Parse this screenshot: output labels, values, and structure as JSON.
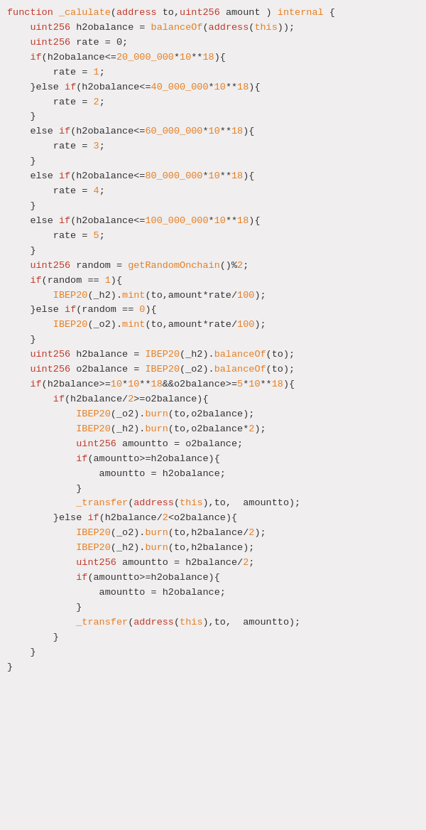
{
  "code": {
    "lines": [
      {
        "id": 1,
        "tokens": [
          {
            "t": "function",
            "c": "kw"
          },
          {
            "t": " ",
            "c": ""
          },
          {
            "t": "_calulate",
            "c": "fn"
          },
          {
            "t": "(",
            "c": ""
          },
          {
            "t": "address",
            "c": "kw"
          },
          {
            "t": " to,",
            "c": ""
          },
          {
            "t": "uint256",
            "c": "kw"
          },
          {
            "t": " amount ) ",
            "c": ""
          },
          {
            "t": "internal",
            "c": "fn"
          },
          {
            "t": " {",
            "c": ""
          }
        ]
      },
      {
        "id": 2,
        "tokens": [
          {
            "t": "    ",
            "c": ""
          },
          {
            "t": "uint256",
            "c": "kw"
          },
          {
            "t": " h2obalance = ",
            "c": ""
          },
          {
            "t": "balanceOf",
            "c": "fn"
          },
          {
            "t": "(",
            "c": ""
          },
          {
            "t": "address",
            "c": "kw"
          },
          {
            "t": "(",
            "c": ""
          },
          {
            "t": "this",
            "c": "fn"
          },
          {
            "t": "));",
            "c": ""
          }
        ]
      },
      {
        "id": 3,
        "tokens": [
          {
            "t": "    ",
            "c": ""
          },
          {
            "t": "uint256",
            "c": "kw"
          },
          {
            "t": " rate = 0;",
            "c": ""
          }
        ]
      },
      {
        "id": 4,
        "tokens": [
          {
            "t": "    ",
            "c": ""
          },
          {
            "t": "if",
            "c": "kw"
          },
          {
            "t": "(h2obalance<=",
            "c": ""
          },
          {
            "t": "20_000_000",
            "c": "fn"
          },
          {
            "t": "*",
            "c": ""
          },
          {
            "t": "10",
            "c": "fn"
          },
          {
            "t": "**",
            "c": ""
          },
          {
            "t": "18",
            "c": "fn"
          },
          {
            "t": "){",
            "c": ""
          }
        ]
      },
      {
        "id": 5,
        "tokens": [
          {
            "t": "        rate = ",
            "c": ""
          },
          {
            "t": "1",
            "c": "fn"
          },
          {
            "t": ";",
            "c": ""
          }
        ]
      },
      {
        "id": 6,
        "tokens": [
          {
            "t": "    }",
            "c": ""
          },
          {
            "t": "else ",
            "c": ""
          },
          {
            "t": "if",
            "c": "kw"
          },
          {
            "t": "(h2obalance<=",
            "c": ""
          },
          {
            "t": "40_000_000",
            "c": "fn"
          },
          {
            "t": "*",
            "c": ""
          },
          {
            "t": "10",
            "c": "fn"
          },
          {
            "t": "**",
            "c": ""
          },
          {
            "t": "18",
            "c": "fn"
          },
          {
            "t": "){",
            "c": ""
          }
        ]
      },
      {
        "id": 7,
        "tokens": [
          {
            "t": "        rate = ",
            "c": ""
          },
          {
            "t": "2",
            "c": "fn"
          },
          {
            "t": ";",
            "c": ""
          }
        ]
      },
      {
        "id": 8,
        "tokens": [
          {
            "t": "    }",
            "c": ""
          }
        ]
      },
      {
        "id": 9,
        "tokens": [
          {
            "t": "    ",
            "c": ""
          },
          {
            "t": "else ",
            "c": ""
          },
          {
            "t": "if",
            "c": "kw"
          },
          {
            "t": "(h2obalance<=",
            "c": ""
          },
          {
            "t": "60_000_000",
            "c": "fn"
          },
          {
            "t": "*",
            "c": ""
          },
          {
            "t": "10",
            "c": "fn"
          },
          {
            "t": "**",
            "c": ""
          },
          {
            "t": "18",
            "c": "fn"
          },
          {
            "t": "){",
            "c": ""
          }
        ]
      },
      {
        "id": 10,
        "tokens": [
          {
            "t": "        rate = ",
            "c": ""
          },
          {
            "t": "3",
            "c": "fn"
          },
          {
            "t": ";",
            "c": ""
          }
        ]
      },
      {
        "id": 11,
        "tokens": [
          {
            "t": "    }",
            "c": ""
          }
        ]
      },
      {
        "id": 12,
        "tokens": [
          {
            "t": "    ",
            "c": ""
          },
          {
            "t": "else ",
            "c": ""
          },
          {
            "t": "if",
            "c": "kw"
          },
          {
            "t": "(h2obalance<=",
            "c": ""
          },
          {
            "t": "80_000_000",
            "c": "fn"
          },
          {
            "t": "*",
            "c": ""
          },
          {
            "t": "10",
            "c": "fn"
          },
          {
            "t": "**",
            "c": ""
          },
          {
            "t": "18",
            "c": "fn"
          },
          {
            "t": "){",
            "c": ""
          }
        ]
      },
      {
        "id": 13,
        "tokens": [
          {
            "t": "        rate = ",
            "c": ""
          },
          {
            "t": "4",
            "c": "fn"
          },
          {
            "t": ";",
            "c": ""
          }
        ]
      },
      {
        "id": 14,
        "tokens": [
          {
            "t": "    }",
            "c": ""
          }
        ]
      },
      {
        "id": 15,
        "tokens": [
          {
            "t": "    ",
            "c": ""
          },
          {
            "t": "else ",
            "c": ""
          },
          {
            "t": "if",
            "c": "kw"
          },
          {
            "t": "(h2obalance<=",
            "c": ""
          },
          {
            "t": "100_000_000",
            "c": "fn"
          },
          {
            "t": "*",
            "c": ""
          },
          {
            "t": "10",
            "c": "fn"
          },
          {
            "t": "**",
            "c": ""
          },
          {
            "t": "18",
            "c": "fn"
          },
          {
            "t": "){",
            "c": ""
          }
        ]
      },
      {
        "id": 16,
        "tokens": [
          {
            "t": "        rate = ",
            "c": ""
          },
          {
            "t": "5",
            "c": "fn"
          },
          {
            "t": ";",
            "c": ""
          }
        ]
      },
      {
        "id": 17,
        "tokens": [
          {
            "t": "    }",
            "c": ""
          }
        ]
      },
      {
        "id": 18,
        "tokens": [
          {
            "t": "    ",
            "c": ""
          },
          {
            "t": "uint256",
            "c": "kw"
          },
          {
            "t": " random = ",
            "c": ""
          },
          {
            "t": "getRandomOnchain",
            "c": "fn"
          },
          {
            "t": "()%",
            "c": ""
          },
          {
            "t": "2",
            "c": "fn"
          },
          {
            "t": ";",
            "c": ""
          }
        ]
      },
      {
        "id": 19,
        "tokens": [
          {
            "t": "    ",
            "c": ""
          },
          {
            "t": "if",
            "c": "kw"
          },
          {
            "t": "(random == ",
            "c": ""
          },
          {
            "t": "1",
            "c": "fn"
          },
          {
            "t": "){",
            "c": ""
          }
        ]
      },
      {
        "id": 20,
        "tokens": [
          {
            "t": "        ",
            "c": ""
          },
          {
            "t": "IBEP20",
            "c": "fn"
          },
          {
            "t": "(_h2).",
            "c": ""
          },
          {
            "t": "mint",
            "c": "fn"
          },
          {
            "t": "(to,amount*rate/",
            "c": ""
          },
          {
            "t": "100",
            "c": "fn"
          },
          {
            "t": ");",
            "c": ""
          }
        ]
      },
      {
        "id": 21,
        "tokens": [
          {
            "t": "    }",
            "c": ""
          },
          {
            "t": "else ",
            "c": ""
          },
          {
            "t": "if",
            "c": "kw"
          },
          {
            "t": "(random == ",
            "c": ""
          },
          {
            "t": "0",
            "c": "fn"
          },
          {
            "t": "){",
            "c": ""
          }
        ]
      },
      {
        "id": 22,
        "tokens": [
          {
            "t": "        ",
            "c": ""
          },
          {
            "t": "IBEP20",
            "c": "fn"
          },
          {
            "t": "(_o2).",
            "c": ""
          },
          {
            "t": "mint",
            "c": "fn"
          },
          {
            "t": "(to,amount*rate/",
            "c": ""
          },
          {
            "t": "100",
            "c": "fn"
          },
          {
            "t": ");",
            "c": ""
          }
        ]
      },
      {
        "id": 23,
        "tokens": [
          {
            "t": "    }",
            "c": ""
          }
        ]
      },
      {
        "id": 24,
        "tokens": [
          {
            "t": "    ",
            "c": ""
          },
          {
            "t": "uint256",
            "c": "kw"
          },
          {
            "t": " h2balance = ",
            "c": ""
          },
          {
            "t": "IBEP20",
            "c": "fn"
          },
          {
            "t": "(_h2).",
            "c": ""
          },
          {
            "t": "balanceOf",
            "c": "fn"
          },
          {
            "t": "(to);",
            "c": ""
          }
        ]
      },
      {
        "id": 25,
        "tokens": [
          {
            "t": "    ",
            "c": ""
          },
          {
            "t": "uint256",
            "c": "kw"
          },
          {
            "t": " o2balance = ",
            "c": ""
          },
          {
            "t": "IBEP20",
            "c": "fn"
          },
          {
            "t": "(_o2).",
            "c": ""
          },
          {
            "t": "balanceOf",
            "c": "fn"
          },
          {
            "t": "(to);",
            "c": ""
          }
        ]
      },
      {
        "id": 26,
        "tokens": [
          {
            "t": "    ",
            "c": ""
          },
          {
            "t": "if",
            "c": "kw"
          },
          {
            "t": "(h2balance>=",
            "c": ""
          },
          {
            "t": "10",
            "c": "fn"
          },
          {
            "t": "*",
            "c": ""
          },
          {
            "t": "10",
            "c": "fn"
          },
          {
            "t": "**",
            "c": ""
          },
          {
            "t": "18",
            "c": "fn"
          },
          {
            "t": "&&o2balance>=",
            "c": ""
          },
          {
            "t": "5",
            "c": "fn"
          },
          {
            "t": "*",
            "c": ""
          },
          {
            "t": "10",
            "c": "fn"
          },
          {
            "t": "**",
            "c": ""
          },
          {
            "t": "18",
            "c": "fn"
          },
          {
            "t": "){",
            "c": ""
          }
        ]
      },
      {
        "id": 27,
        "tokens": [
          {
            "t": "        ",
            "c": ""
          },
          {
            "t": "if",
            "c": "kw"
          },
          {
            "t": "(h2balance/",
            "c": ""
          },
          {
            "t": "2",
            "c": "fn"
          },
          {
            "t": ">=o2balance){",
            "c": ""
          }
        ]
      },
      {
        "id": 28,
        "tokens": [
          {
            "t": "            ",
            "c": ""
          },
          {
            "t": "IBEP20",
            "c": "fn"
          },
          {
            "t": "(_o2).",
            "c": ""
          },
          {
            "t": "burn",
            "c": "fn"
          },
          {
            "t": "(to,o2balance);",
            "c": ""
          }
        ]
      },
      {
        "id": 29,
        "tokens": [
          {
            "t": "            ",
            "c": ""
          },
          {
            "t": "IBEP20",
            "c": "fn"
          },
          {
            "t": "(_h2).",
            "c": ""
          },
          {
            "t": "burn",
            "c": "fn"
          },
          {
            "t": "(to,o2balance*",
            "c": ""
          },
          {
            "t": "2",
            "c": "fn"
          },
          {
            "t": ");",
            "c": ""
          }
        ]
      },
      {
        "id": 30,
        "tokens": [
          {
            "t": "            ",
            "c": ""
          },
          {
            "t": "uint256",
            "c": "kw"
          },
          {
            "t": " amountto = o2balance;",
            "c": ""
          }
        ]
      },
      {
        "id": 31,
        "tokens": [
          {
            "t": "            ",
            "c": ""
          },
          {
            "t": "if",
            "c": "kw"
          },
          {
            "t": "(amountto>=h2obalance){",
            "c": ""
          }
        ]
      },
      {
        "id": 32,
        "tokens": [
          {
            "t": "                amountto = h2obalance;",
            "c": ""
          }
        ]
      },
      {
        "id": 33,
        "tokens": [
          {
            "t": "            }",
            "c": ""
          }
        ]
      },
      {
        "id": 34,
        "tokens": [
          {
            "t": "            ",
            "c": ""
          },
          {
            "t": "_transfer",
            "c": "fn"
          },
          {
            "t": "(",
            "c": ""
          },
          {
            "t": "address",
            "c": "kw"
          },
          {
            "t": "(",
            "c": ""
          },
          {
            "t": "this",
            "c": "fn"
          },
          {
            "t": "),to,  amountto);",
            "c": ""
          }
        ]
      },
      {
        "id": 35,
        "tokens": [
          {
            "t": "        }",
            "c": ""
          },
          {
            "t": "else ",
            "c": ""
          },
          {
            "t": "if",
            "c": "kw"
          },
          {
            "t": "(h2balance/",
            "c": ""
          },
          {
            "t": "2",
            "c": "fn"
          },
          {
            "t": "<o2balance){",
            "c": ""
          }
        ]
      },
      {
        "id": 36,
        "tokens": [
          {
            "t": "            ",
            "c": ""
          },
          {
            "t": "IBEP20",
            "c": "fn"
          },
          {
            "t": "(_o2).",
            "c": ""
          },
          {
            "t": "burn",
            "c": "fn"
          },
          {
            "t": "(to,h2balance/",
            "c": ""
          },
          {
            "t": "2",
            "c": "fn"
          },
          {
            "t": ");",
            "c": ""
          }
        ]
      },
      {
        "id": 37,
        "tokens": [
          {
            "t": "            ",
            "c": ""
          },
          {
            "t": "IBEP20",
            "c": "fn"
          },
          {
            "t": "(_h2).",
            "c": ""
          },
          {
            "t": "burn",
            "c": "fn"
          },
          {
            "t": "(to,h2balance);",
            "c": ""
          }
        ]
      },
      {
        "id": 38,
        "tokens": [
          {
            "t": "            ",
            "c": ""
          },
          {
            "t": "uint256",
            "c": "kw"
          },
          {
            "t": " amountto = h2balance/",
            "c": ""
          },
          {
            "t": "2",
            "c": "fn"
          },
          {
            "t": ";",
            "c": ""
          }
        ]
      },
      {
        "id": 39,
        "tokens": [
          {
            "t": "            ",
            "c": ""
          },
          {
            "t": "if",
            "c": "kw"
          },
          {
            "t": "(amountto>=h2obalance){",
            "c": ""
          }
        ]
      },
      {
        "id": 40,
        "tokens": [
          {
            "t": "                amountto = h2obalance;",
            "c": ""
          }
        ]
      },
      {
        "id": 41,
        "tokens": [
          {
            "t": "            }",
            "c": ""
          }
        ]
      },
      {
        "id": 42,
        "tokens": [
          {
            "t": "            ",
            "c": ""
          },
          {
            "t": "_transfer",
            "c": "fn"
          },
          {
            "t": "(",
            "c": ""
          },
          {
            "t": "address",
            "c": "kw"
          },
          {
            "t": "(",
            "c": ""
          },
          {
            "t": "this",
            "c": "fn"
          },
          {
            "t": "),to,  amountto);",
            "c": ""
          }
        ]
      },
      {
        "id": 43,
        "tokens": [
          {
            "t": "        }",
            "c": ""
          }
        ]
      },
      {
        "id": 44,
        "tokens": [
          {
            "t": "    }",
            "c": ""
          }
        ]
      },
      {
        "id": 45,
        "tokens": [
          {
            "t": "}",
            "c": ""
          }
        ]
      }
    ]
  }
}
